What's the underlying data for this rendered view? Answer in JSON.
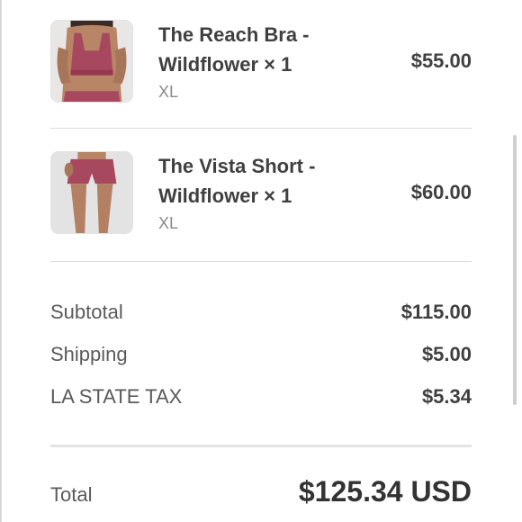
{
  "cart": {
    "items": [
      {
        "name_line1": "The Reach Bra -",
        "name_line2": "Wildflower × 1",
        "variant": "XL",
        "price": "$55.00",
        "image": "product-photo-bra"
      },
      {
        "name_line1": "The Vista Short -",
        "name_line2": "Wildflower × 1",
        "variant": "XL",
        "price": "$60.00",
        "image": "product-photo-shorts"
      }
    ]
  },
  "summary": {
    "subtotal_label": "Subtotal",
    "subtotal_value": "$115.00",
    "shipping_label": "Shipping",
    "shipping_value": "$5.00",
    "tax_label": "LA STATE TAX",
    "tax_value": "$5.34",
    "total_label": "Total",
    "total_value": "$125.34 USD"
  },
  "colors": {
    "product_color": "#a8485f",
    "text_dark": "#404040",
    "text_muted": "#8a8a8a"
  }
}
